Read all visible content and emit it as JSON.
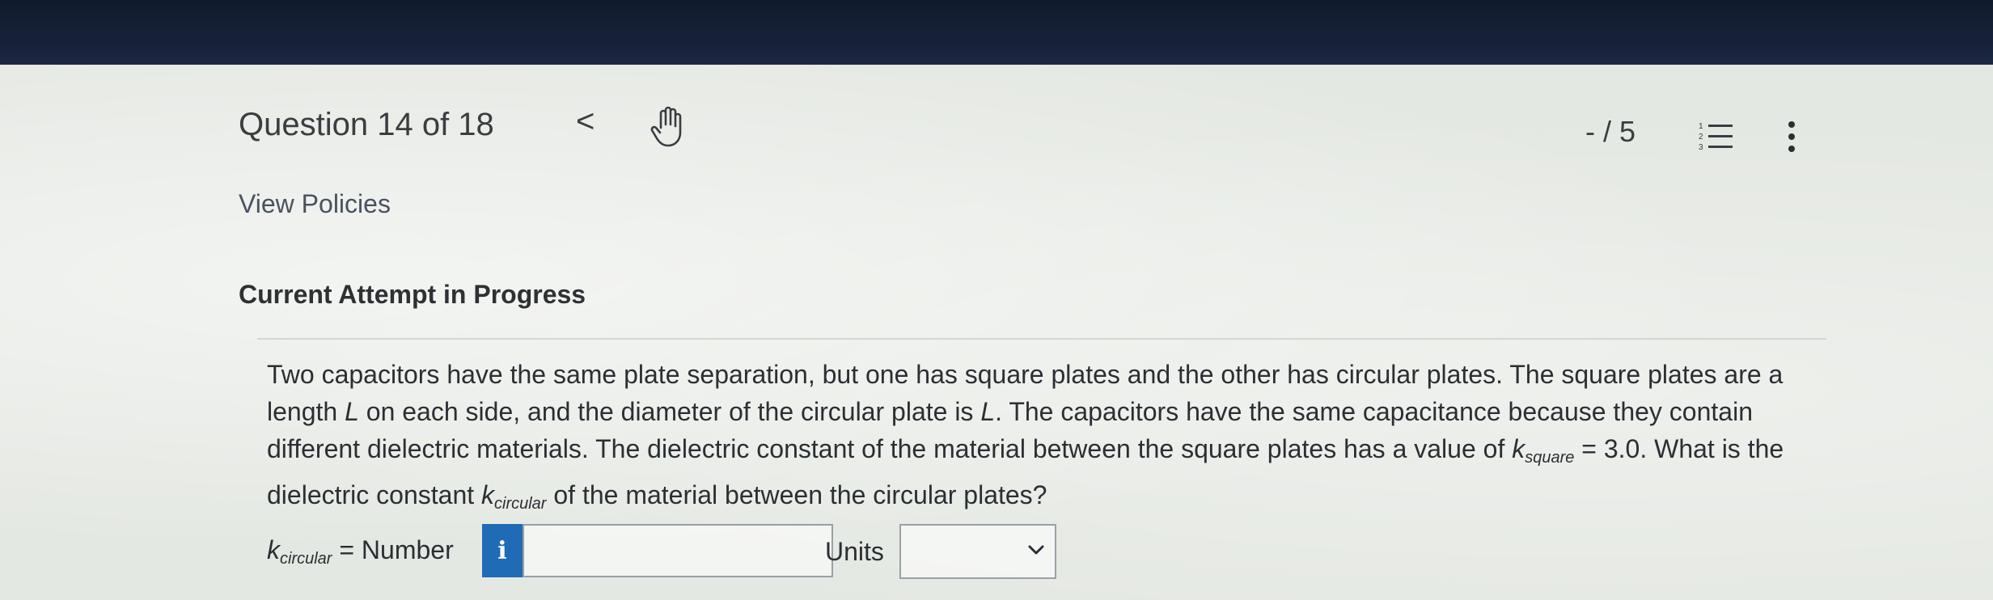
{
  "header": {
    "question_label": "Question 14 of 18",
    "prev_label": "<",
    "score": "- / 5"
  },
  "icons": {
    "prev": "chevron-left-icon",
    "hand": "hand-pointer-icon",
    "list": "numbered-list-icon",
    "more": "vertical-ellipsis-icon",
    "info": "info-icon",
    "chevron": "chevron-down-icon"
  },
  "links": {
    "view_policies": "View Policies"
  },
  "section": {
    "attempt_heading": "Current Attempt in Progress"
  },
  "question": {
    "line1": "Two capacitors have the same plate separation, but one has square plates and the other has circular plates. The square plates are a",
    "line2_a": "length ",
    "line2_var": "L",
    "line2_b": " on each side, and the diameter of the circular plate is ",
    "line2_var2": "L",
    "line2_c": ". The capacitors have the same capacitance because they contain",
    "line3_a": "different dielectric materials. The dielectric constant of the material between the square plates has a value of ",
    "line3_k": "k",
    "line3_sub": "square",
    "line3_b": " = 3.0. What is the",
    "line4_a": "dielectric constant ",
    "line4_k": "k",
    "line4_sub": "circular",
    "line4_b": " of the material between the circular plates?"
  },
  "answer": {
    "k": "k",
    "sub": "circular",
    "label_rest": " = Number",
    "info_label": "i",
    "number_value": "",
    "units_label": "Units",
    "units_selected": ""
  },
  "colors": {
    "info_button": "#1f6bb5",
    "bezel": "#111a2c",
    "page_bg": "#e4e8e2"
  }
}
